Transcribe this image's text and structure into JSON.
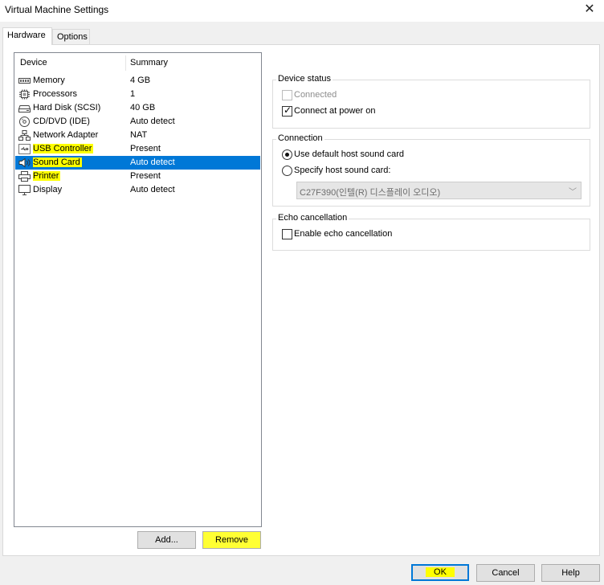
{
  "window": {
    "title": "Virtual Machine Settings",
    "close_glyph": "✕"
  },
  "tabs": [
    {
      "label": "Hardware",
      "active": true
    },
    {
      "label": "Options",
      "active": false
    }
  ],
  "device_list": {
    "headers": {
      "device": "Device",
      "summary": "Summary"
    },
    "items": [
      {
        "name": "Memory",
        "summary": "4 GB",
        "icon": "memory-icon",
        "highlighted": false,
        "selected": false
      },
      {
        "name": "Processors",
        "summary": "1",
        "icon": "processor-icon",
        "highlighted": false,
        "selected": false
      },
      {
        "name": "Hard Disk (SCSI)",
        "summary": "40 GB",
        "icon": "hard-disk-icon",
        "highlighted": false,
        "selected": false
      },
      {
        "name": "CD/DVD (IDE)",
        "summary": "Auto detect",
        "icon": "cd-dvd-icon",
        "highlighted": false,
        "selected": false
      },
      {
        "name": "Network Adapter",
        "summary": "NAT",
        "icon": "network-adapter-icon",
        "highlighted": false,
        "selected": false
      },
      {
        "name": "USB Controller",
        "summary": "Present",
        "icon": "usb-controller-icon",
        "highlighted": true,
        "selected": false
      },
      {
        "name": "Sound Card",
        "summary": "Auto detect",
        "icon": "sound-card-icon",
        "highlighted": true,
        "selected": true
      },
      {
        "name": "Printer",
        "summary": "Present",
        "icon": "printer-icon",
        "highlighted": true,
        "selected": false
      },
      {
        "name": "Display",
        "summary": "Auto detect",
        "icon": "display-icon",
        "highlighted": false,
        "selected": false
      }
    ]
  },
  "list_buttons": {
    "add": "Add...",
    "remove": "Remove"
  },
  "device_status": {
    "title": "Device status",
    "connected": {
      "label": "Connected",
      "checked": false,
      "disabled": true
    },
    "connect_at_power_on": {
      "label": "Connect at power on",
      "checked": true
    }
  },
  "connection": {
    "title": "Connection",
    "use_default": {
      "label": "Use default host sound card",
      "selected": true
    },
    "specify": {
      "label": "Specify host sound card:",
      "selected": false
    },
    "host_card_value": "C27F390(인텔(R) 디스플레이 오디오)"
  },
  "echo": {
    "title": "Echo cancellation",
    "enable": {
      "label": "Enable echo cancellation",
      "checked": false
    }
  },
  "footer_buttons": {
    "ok": "OK",
    "cancel": "Cancel",
    "help": "Help"
  },
  "colors": {
    "selection": "#0078d7",
    "highlight": "#ffff00"
  }
}
